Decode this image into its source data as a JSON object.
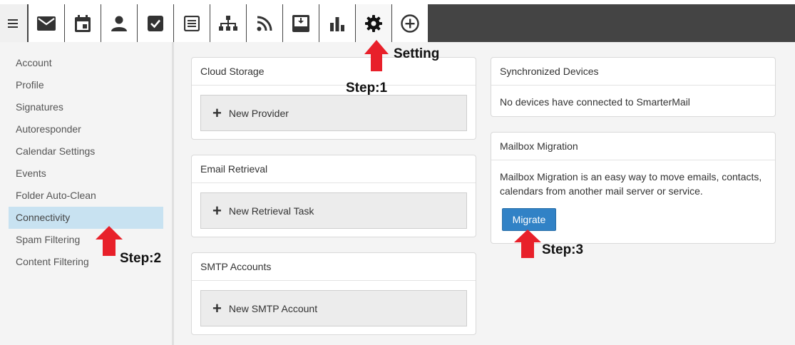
{
  "toolbar": {
    "menu_icon": "hamburger-menu-icon",
    "buttons": [
      {
        "icon": "mail-icon"
      },
      {
        "icon": "calendar-icon"
      },
      {
        "icon": "contacts-icon"
      },
      {
        "icon": "tasks-icon"
      },
      {
        "icon": "notes-icon"
      },
      {
        "icon": "sitemap-icon"
      },
      {
        "icon": "rss-icon"
      },
      {
        "icon": "archive-download-icon"
      },
      {
        "icon": "reports-icon"
      },
      {
        "icon": "settings-gear-icon",
        "active": true
      },
      {
        "icon": "add-circle-icon"
      }
    ]
  },
  "sidebar": {
    "items": [
      {
        "label": "Account"
      },
      {
        "label": "Profile"
      },
      {
        "label": "Signatures"
      },
      {
        "label": "Autoresponder"
      },
      {
        "label": "Calendar Settings"
      },
      {
        "label": "Events"
      },
      {
        "label": "Folder Auto-Clean"
      },
      {
        "label": "Connectivity",
        "selected": true
      },
      {
        "label": "Spam Filtering"
      },
      {
        "label": "Content Filtering"
      }
    ]
  },
  "cards": {
    "cloud_storage": {
      "title": "Cloud Storage",
      "button": "New Provider"
    },
    "email_retrieval": {
      "title": "Email Retrieval",
      "button": "New Retrieval Task"
    },
    "smtp_accounts": {
      "title": "SMTP Accounts",
      "button": "New SMTP Account"
    },
    "synchronized_devices": {
      "title": "Synchronized Devices",
      "text": "No devices have connected to SmarterMail"
    },
    "mailbox_migration": {
      "title": "Mailbox Migration",
      "text_line1": "Mailbox Migration is an easy way to move emails, contacts,",
      "text_line2": "calendars from another mail server or service.",
      "button": "Migrate"
    }
  },
  "annotations": {
    "setting": "Setting",
    "step1": "Step:1",
    "step2": "Step:2",
    "step3": "Step:3"
  },
  "colors": {
    "toolbar": "#444444",
    "selected_item": "#c8e2f1",
    "primary_button": "#3182c6",
    "arrow": "#e8202a"
  }
}
